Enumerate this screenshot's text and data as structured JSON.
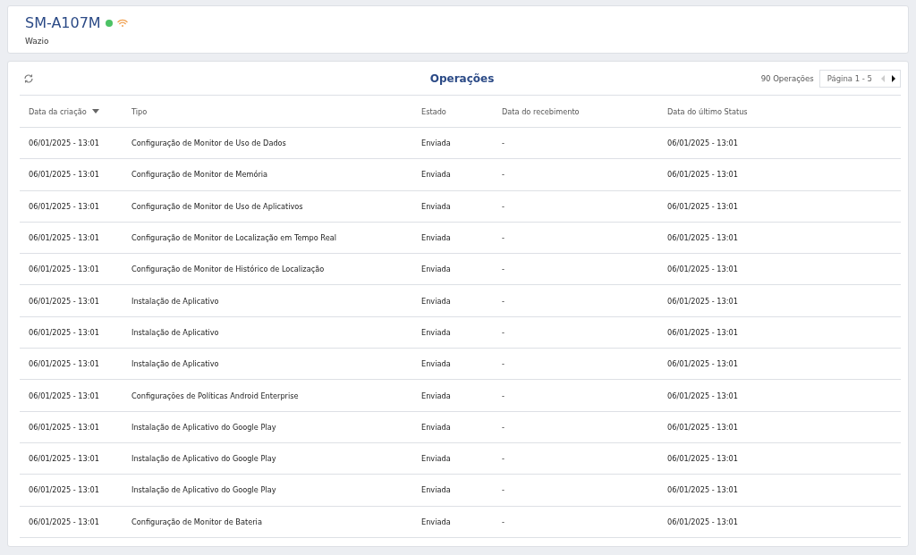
{
  "device": {
    "name": "SM-A107M",
    "online": true,
    "subtitle": "Wazio"
  },
  "operations": {
    "title": "Operações",
    "count": "90 Operações",
    "pager": {
      "label": "Página 1 - 5",
      "prev_disabled": true,
      "next_disabled": false
    },
    "columns": [
      {
        "label": "Data da criação",
        "sorted": true
      },
      {
        "label": "Tipo",
        "sorted": false
      },
      {
        "label": "Estado",
        "sorted": false
      },
      {
        "label": "Data do recebimento",
        "sorted": false
      },
      {
        "label": "Data do último Status",
        "sorted": false
      }
    ],
    "rows": [
      [
        "06/01/2025 - 13:01",
        "Configuração de Monitor de Uso de Dados",
        "Enviada",
        "-",
        "06/01/2025 - 13:01"
      ],
      [
        "06/01/2025 - 13:01",
        "Configuração de Monitor de Memória",
        "Enviada",
        "-",
        "06/01/2025 - 13:01"
      ],
      [
        "06/01/2025 - 13:01",
        "Configuração de Monitor de Uso de Aplicativos",
        "Enviada",
        "-",
        "06/01/2025 - 13:01"
      ],
      [
        "06/01/2025 - 13:01",
        "Configuração de Monitor de Localização em Tempo Real",
        "Enviada",
        "-",
        "06/01/2025 - 13:01"
      ],
      [
        "06/01/2025 - 13:01",
        "Configuração de Monitor de Histórico de Localização",
        "Enviada",
        "-",
        "06/01/2025 - 13:01"
      ],
      [
        "06/01/2025 - 13:01",
        "Instalação de Aplicativo",
        "Enviada",
        "-",
        "06/01/2025 - 13:01"
      ],
      [
        "06/01/2025 - 13:01",
        "Instalação de Aplicativo",
        "Enviada",
        "-",
        "06/01/2025 - 13:01"
      ],
      [
        "06/01/2025 - 13:01",
        "Instalação de Aplicativo",
        "Enviada",
        "-",
        "06/01/2025 - 13:01"
      ],
      [
        "06/01/2025 - 13:01",
        "Configurações de Políticas Android Enterprise",
        "Enviada",
        "-",
        "06/01/2025 - 13:01"
      ],
      [
        "06/01/2025 - 13:01",
        "Instalação de Aplicativo do Google Play",
        "Enviada",
        "-",
        "06/01/2025 - 13:01"
      ],
      [
        "06/01/2025 - 13:01",
        "Instalação de Aplicativo do Google Play",
        "Enviada",
        "-",
        "06/01/2025 - 13:01"
      ],
      [
        "06/01/2025 - 13:01",
        "Instalação de Aplicativo do Google Play",
        "Enviada",
        "-",
        "06/01/2025 - 13:01"
      ],
      [
        "06/01/2025 - 13:01",
        "Configuração de Monitor de Bateria",
        "Enviada",
        "-",
        "06/01/2025 - 13:01"
      ]
    ]
  }
}
